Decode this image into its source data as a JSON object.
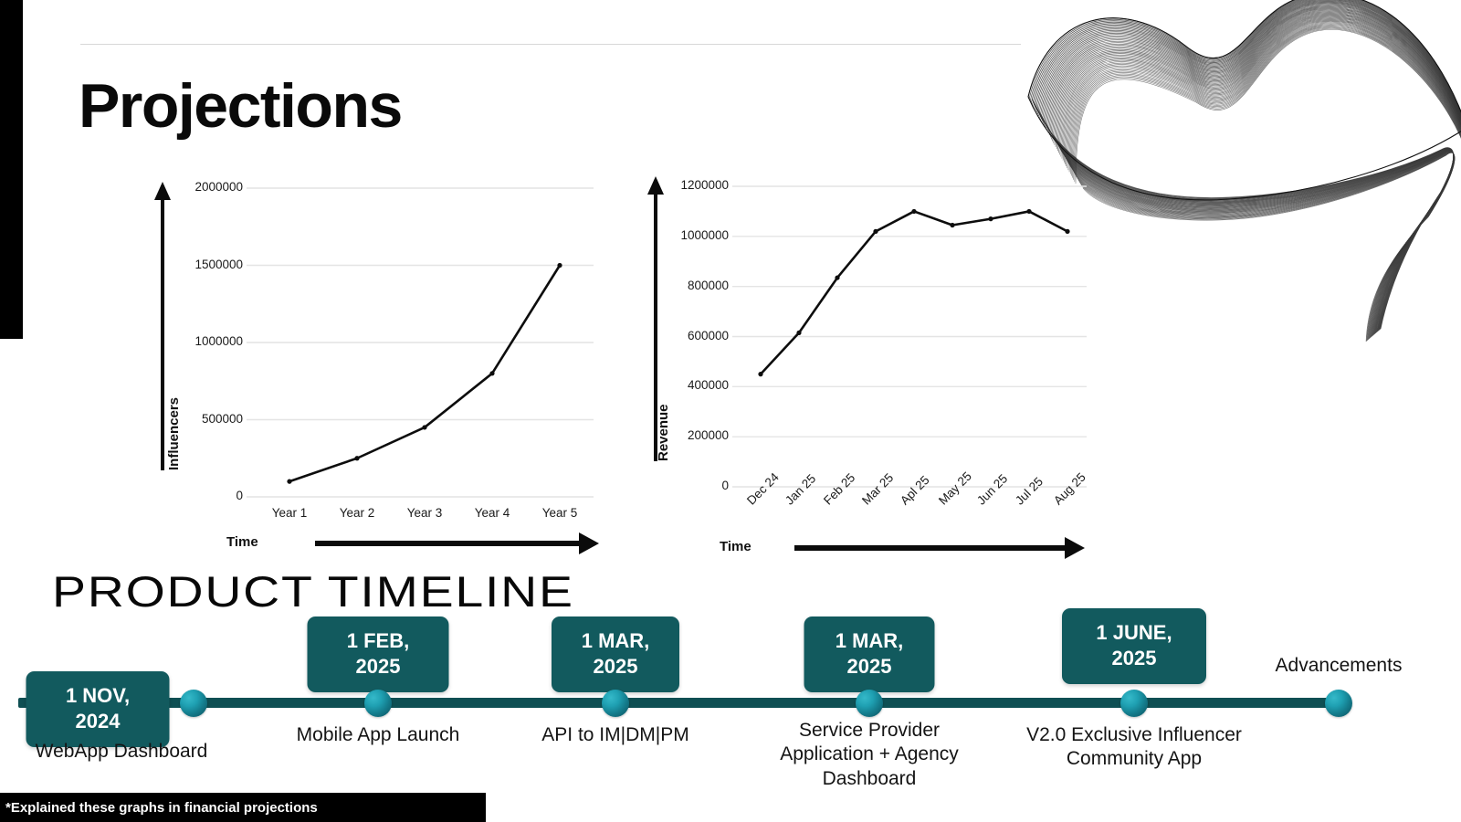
{
  "page": {
    "title": "Projections",
    "timeline_heading": "PRODUCT  TIMELINE",
    "footnote": "*Explained these graphs in financial projections",
    "accent_teal": "#125a5e",
    "accent_line": "#0e4f53",
    "dot_highlight": "#35b9c9",
    "black": "#000000"
  },
  "chart_data": [
    {
      "type": "line",
      "id": "influencers",
      "title": "",
      "xlabel": "Time",
      "ylabel": "Influencers",
      "categories": [
        "Year 1",
        "Year 2",
        "Year 3",
        "Year 4",
        "Year 5"
      ],
      "values": [
        100000,
        250000,
        450000,
        800000,
        1500000
      ],
      "yticks": [
        2000000,
        1500000,
        1000000,
        500000,
        0
      ],
      "ylim": [
        0,
        2000000
      ],
      "grid": true,
      "legend": "none",
      "series_color": "#0d0d0d"
    },
    {
      "type": "line",
      "id": "revenue",
      "title": "",
      "xlabel": "Time",
      "ylabel": "Revenue",
      "categories": [
        "Dec 24",
        "Jan 25",
        "Feb 25",
        "Mar 25",
        "Apl 25",
        "May 25",
        "Jun 25",
        "Jul 25",
        "Aug 25"
      ],
      "values": [
        450000,
        615000,
        835000,
        1020000,
        1100000,
        1045000,
        1070000,
        1100000,
        1020000
      ],
      "yticks": [
        1200000,
        1000000,
        800000,
        600000,
        400000,
        200000,
        0
      ],
      "ylim": [
        0,
        1200000
      ],
      "grid": true,
      "legend": "none",
      "series_color": "#0d0d0d"
    }
  ],
  "timeline": {
    "milestones": [
      {
        "date": "1 NOV,\n2024",
        "label": "WebApp Dashboard"
      },
      {
        "date": "1 FEB,\n2025",
        "label": "Mobile App Launch"
      },
      {
        "date": "1 MAR,\n2025",
        "label": "API to IM|DM|PM"
      },
      {
        "date": "1 MAR,\n2025",
        "label": "Service Provider\nApplication + Agency\nDashboard"
      },
      {
        "date": "1 JUNE,\n2025",
        "label": "V2.0 Exclusive Influencer\nCommunity App"
      },
      {
        "date": "",
        "label": "Advancements"
      }
    ]
  }
}
